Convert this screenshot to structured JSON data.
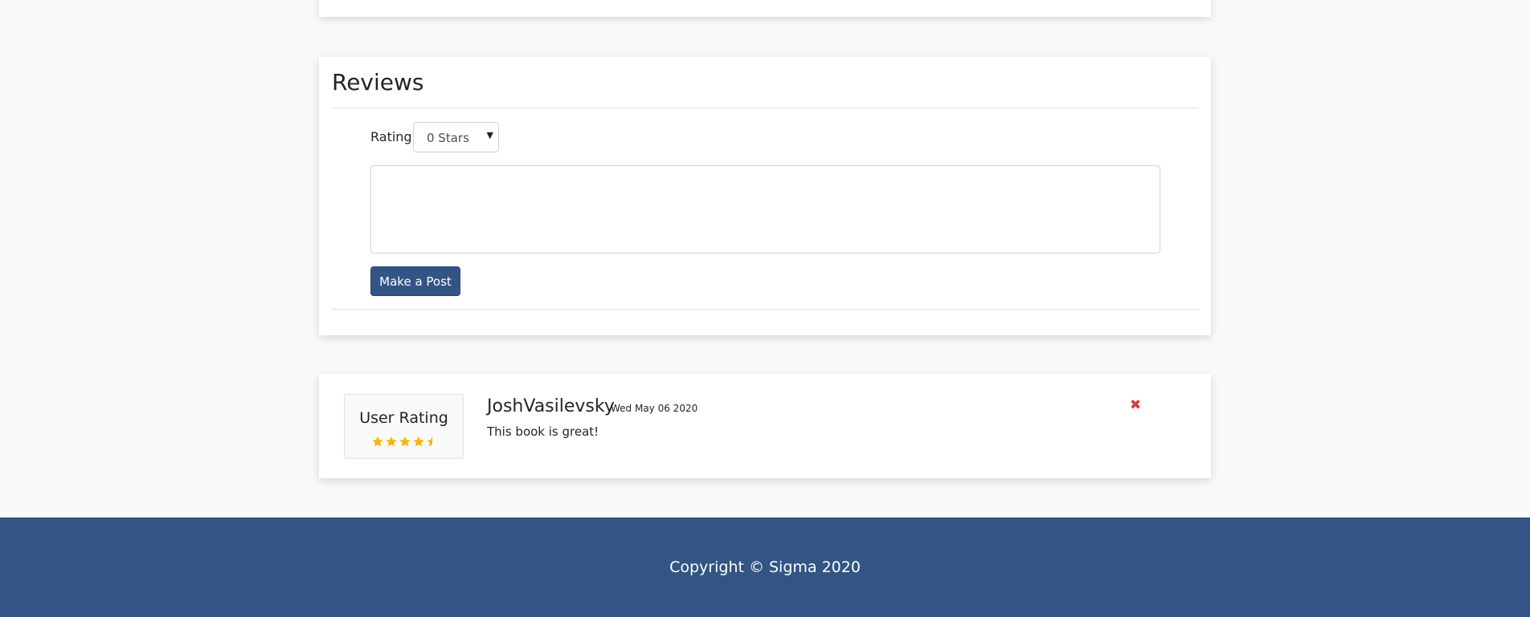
{
  "reviews_section": {
    "title": "Reviews",
    "rating_label": "Rating",
    "rating_selected": "0 Stars",
    "textarea_value": "",
    "textarea_placeholder": "",
    "post_button_label": "Make a Post"
  },
  "review": {
    "user_rating_label": "User Rating",
    "rating_value": 4.5,
    "rating_max": 5,
    "reviewer_name": "JoshVasilevsky",
    "date": "Wed May 06 2020",
    "text": "This book is great!",
    "delete_icon": "close-icon"
  },
  "footer": {
    "copyright": "Copyright © Sigma 2020"
  },
  "colors": {
    "brand_blue": "#335585",
    "star_gold": "#f5b50a",
    "delete_red": "#dc3545",
    "page_background": "#f9f9f9"
  }
}
